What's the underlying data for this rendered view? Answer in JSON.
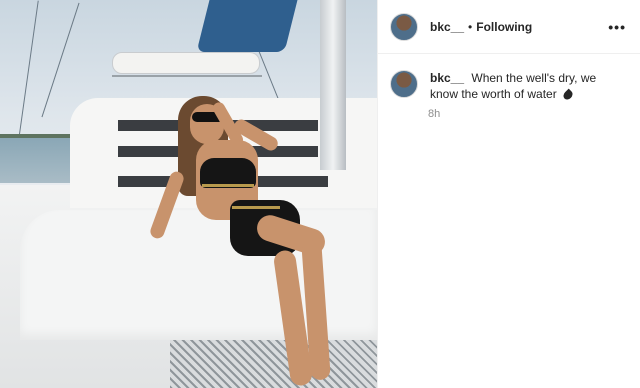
{
  "post": {
    "username": "bkc__",
    "separator": "•",
    "follow_status": "Following",
    "more_icon": "more-options-icon",
    "caption_text": "When the well's dry, we know the worth of water",
    "caption_emoji_icon": "water-drop-icon",
    "time_ago": "8h"
  }
}
